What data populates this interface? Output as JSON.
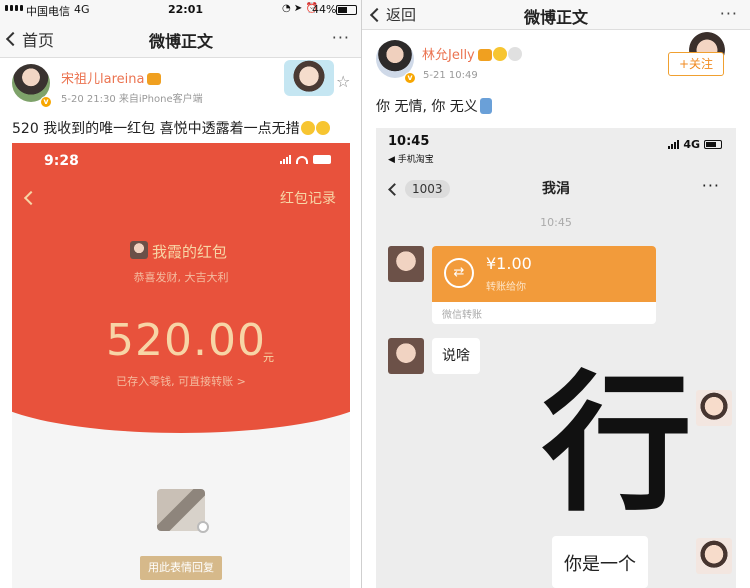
{
  "left": {
    "statusbar": {
      "carrier": "中国电信",
      "network": "4G",
      "time": "22:01",
      "battery": "44%",
      "icons": "◔ ➤ ⏰"
    },
    "navbar": {
      "back_label": "首页",
      "title": "微博正文",
      "more": "···"
    },
    "post": {
      "username": "宋祖儿lareina",
      "meta": "5-20 21:30  来自iPhone客户端",
      "text": "520 我收到的唯一红包 喜悦中透露着一点无措"
    },
    "red_packet": {
      "time": "9:28",
      "record_label": "红包记录",
      "title": "我霞的红包",
      "greeting": "恭喜发财, 大吉大利",
      "amount": "520.00",
      "unit": "元",
      "note": "已存入零钱, 可直接转账 >",
      "reply_label": "用此表情回复"
    }
  },
  "right": {
    "navbar": {
      "back_label": "返回",
      "title": "微博正文",
      "more": "···"
    },
    "post": {
      "username": "林允Jelly",
      "meta": "5-21 10:49",
      "follow_label": "+关注",
      "text": "你 无情, 你 无义"
    },
    "chat": {
      "status_time": "10:45",
      "status_app": "◀ 手机淘宝",
      "status_network": "4G",
      "back_badge": "1003",
      "title": "我涓",
      "more": "···",
      "timestamp": "10:45",
      "transfer_amount": "¥1.00",
      "transfer_sub": "转账给你",
      "transfer_icon": "⇄",
      "transfer_footer": "微信转账",
      "msg1": "说啥",
      "sticker_char": "行",
      "msg2": "你是一个"
    }
  },
  "colors": {
    "weibo_orange": "#eb7350",
    "red_packet": "#e8523c",
    "packet_gold": "#f7d5a6",
    "transfer_orange": "#f29b3b"
  }
}
